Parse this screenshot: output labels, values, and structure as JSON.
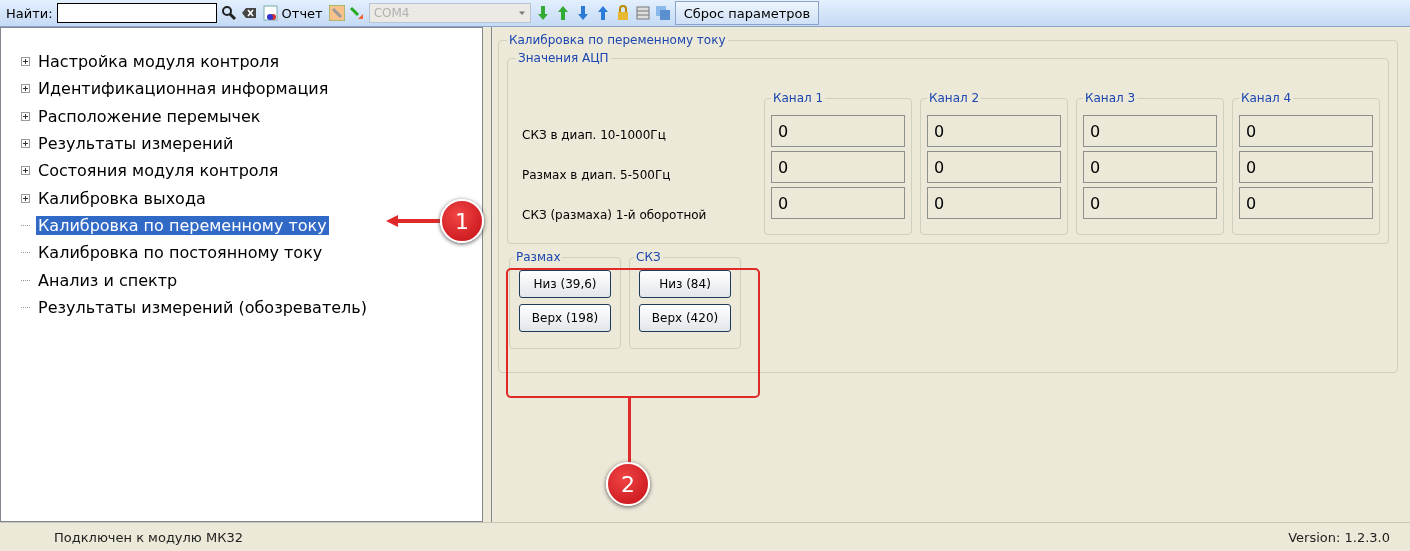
{
  "toolbar": {
    "search_label": "Найти:",
    "report": "Отчет",
    "port": {
      "value": "COM4",
      "disabled": true
    },
    "reset": "Сброс параметров"
  },
  "tree": [
    {
      "label": "Настройка модуля контроля",
      "expandable": true,
      "selected": false
    },
    {
      "label": "Идентификационная информация",
      "expandable": true,
      "selected": false
    },
    {
      "label": "Расположение перемычек",
      "expandable": true,
      "selected": false
    },
    {
      "label": "Результаты измерений",
      "expandable": true,
      "selected": false
    },
    {
      "label": "Состояния модуля контроля",
      "expandable": true,
      "selected": false
    },
    {
      "label": "Калибровка выхода",
      "expandable": true,
      "selected": false
    },
    {
      "label": "Калибровка по переменному току",
      "expandable": false,
      "selected": true
    },
    {
      "label": "Калибровка по постоянному току",
      "expandable": false,
      "selected": false
    },
    {
      "label": "Анализ и спектр",
      "expandable": false,
      "selected": false
    },
    {
      "label": "Результаты измерений (обозреватель)",
      "expandable": false,
      "selected": false
    }
  ],
  "panel": {
    "title": "Калибровка по переменному току",
    "adc": {
      "title": "Значения АЦП",
      "rows": [
        "СКЗ в диап. 10-1000Гц",
        "Размах в диап. 5-500Гц",
        "СКЗ (размаха) 1-й оборотной"
      ],
      "channels": [
        {
          "title": "Канал 1",
          "values": [
            "0",
            "0",
            "0"
          ]
        },
        {
          "title": "Канал 2",
          "values": [
            "0",
            "0",
            "0"
          ]
        },
        {
          "title": "Канал 3",
          "values": [
            "0",
            "0",
            "0"
          ]
        },
        {
          "title": "Канал 4",
          "values": [
            "0",
            "0",
            "0"
          ]
        }
      ]
    },
    "groups": [
      {
        "title": "Размах",
        "buttons": [
          "Низ (39,6)",
          "Верх (198)"
        ]
      },
      {
        "title": "СКЗ",
        "buttons": [
          "Низ (84)",
          "Верх (420)"
        ]
      }
    ]
  },
  "callouts": [
    "1",
    "2"
  ],
  "status_bar": {
    "left": "Подключен к модулю МК32",
    "right": "Version: 1.2.3.0"
  }
}
